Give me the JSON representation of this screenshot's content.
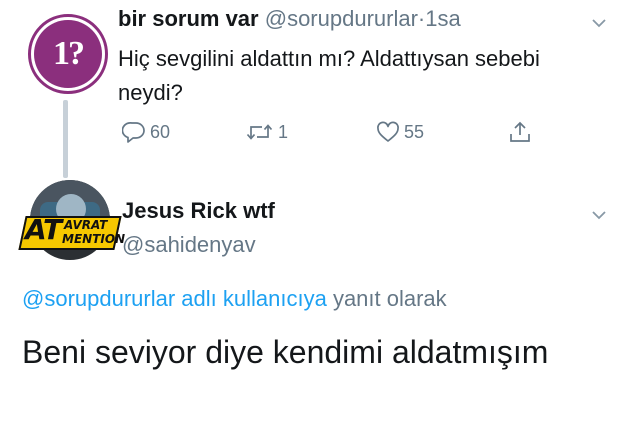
{
  "colors": {
    "text_primary": "#14171a",
    "text_secondary": "#657786",
    "link": "#1da1f2",
    "avatar1_purple": "#8b2f7d",
    "thread_line": "#c7d0d8"
  },
  "tweet1": {
    "avatar_text": "1?",
    "name": "bir sorum var",
    "handle": "@sorupdururlar",
    "separator": "·",
    "time": "1sa",
    "text_line1": "Hiç sevgilini aldattın mı? Aldattıysan sebebi",
    "text_line2": "neydi?",
    "actions": {
      "reply": {
        "icon": "reply-icon",
        "count": "60"
      },
      "retweet": {
        "icon": "retweet-icon",
        "count": "1"
      },
      "like": {
        "icon": "heart-icon",
        "count": "55"
      },
      "share": {
        "icon": "share-icon"
      }
    },
    "menu_icon": "chevron-down-icon"
  },
  "tweet2": {
    "avatar_stamp": {
      "big": "AT",
      "line1": "AVRAT",
      "line2": "MENTION"
    },
    "name": "Jesus Rick wtf",
    "handle": "@sahidenyav",
    "reply_to_link": "@sorupdururlar adlı kullanıcıya",
    "reply_to_suffix": "yanıt olarak",
    "text": "Beni seviyor diye kendimi aldatmışım",
    "menu_icon": "chevron-down-icon"
  }
}
